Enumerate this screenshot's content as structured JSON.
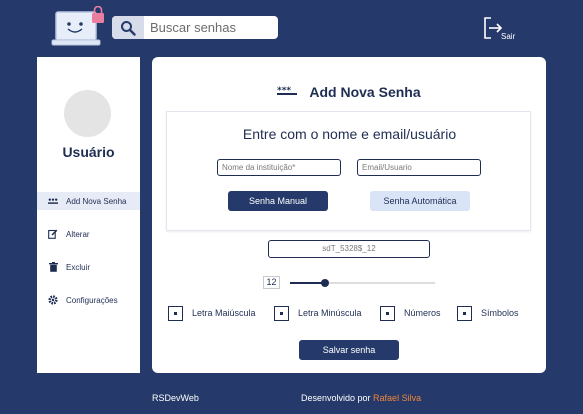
{
  "colors": {
    "background": "#253a6a",
    "primary": "#253a6a",
    "secondary_button": "#d9e4f7",
    "accent": "#f0873a"
  },
  "header": {
    "logo_icon": "laptop-lock-icon",
    "search": {
      "placeholder": "Buscar senhas",
      "icon": "search-icon"
    },
    "logout": {
      "label": "Sair",
      "icon": "logout-icon"
    }
  },
  "sidebar": {
    "username": "Usuário",
    "items": [
      {
        "label": "Add Nova Senha",
        "icon": "password-dots-icon",
        "active": true
      },
      {
        "label": "Alterar",
        "icon": "edit-icon"
      },
      {
        "label": "Excluir",
        "icon": "trash-icon"
      },
      {
        "label": "Configurações",
        "icon": "gear-icon"
      }
    ]
  },
  "main": {
    "title": "Add Nova Senha",
    "title_icon": "password-dots-icon",
    "form": {
      "heading": "Entre com o nome e email/usuário",
      "institution_placeholder": "Nome da instituição*",
      "email_placeholder": "Email/Usuario",
      "manual_button": "Senha Manual",
      "auto_button": "Senha Automática"
    },
    "generated_password": "sdT_5328$_12",
    "length": "12",
    "length_slider_fraction": 0.24,
    "options": [
      {
        "label": "Letra Maiúscula",
        "checked": true
      },
      {
        "label": "Letra Minúscula",
        "checked": true
      },
      {
        "label": "Números",
        "checked": true
      },
      {
        "label": "Símbolos",
        "checked": true
      }
    ],
    "save_button": "Salvar senha"
  },
  "footer": {
    "brand": "RSDevWeb",
    "credit_prefix": "Desenvolvido por ",
    "author": "Rafael Silva"
  }
}
